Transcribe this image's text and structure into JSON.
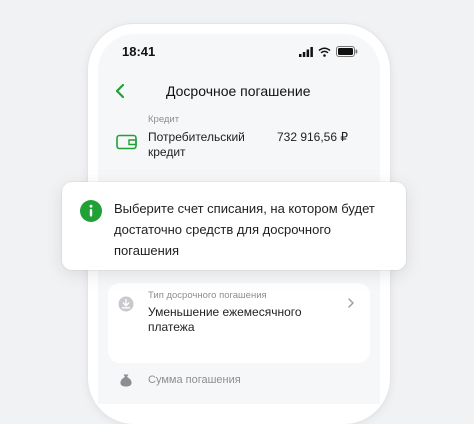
{
  "status_bar": {
    "time": "18:41",
    "icons": [
      "signal-icon",
      "wifi-icon",
      "battery-icon"
    ]
  },
  "header": {
    "title": "Досрочное погашение",
    "back_icon": "chevron-left-icon"
  },
  "credit": {
    "caption": "Кредит",
    "name": "Потребительский кредит",
    "amount": "732 916,56 ₽",
    "icon": "wallet-icon"
  },
  "tooltip": {
    "icon": "info-icon",
    "text": "Выберите счет списания, на котором будет достаточно средств для досрочного погашения"
  },
  "repayment_type": {
    "caption": "Тип досрочного погашения",
    "value": "Уменьшение ежемесячного платежа",
    "icon": "download-icon",
    "chevron": "chevron-right-icon"
  },
  "sum": {
    "caption": "Сумма погашения",
    "icon": "money-bag-icon"
  },
  "colors": {
    "accent": "#21a038",
    "background": "#f1f2f4",
    "card": "#ffffff",
    "text": "#1f1f1f",
    "muted": "#8b8f93"
  }
}
